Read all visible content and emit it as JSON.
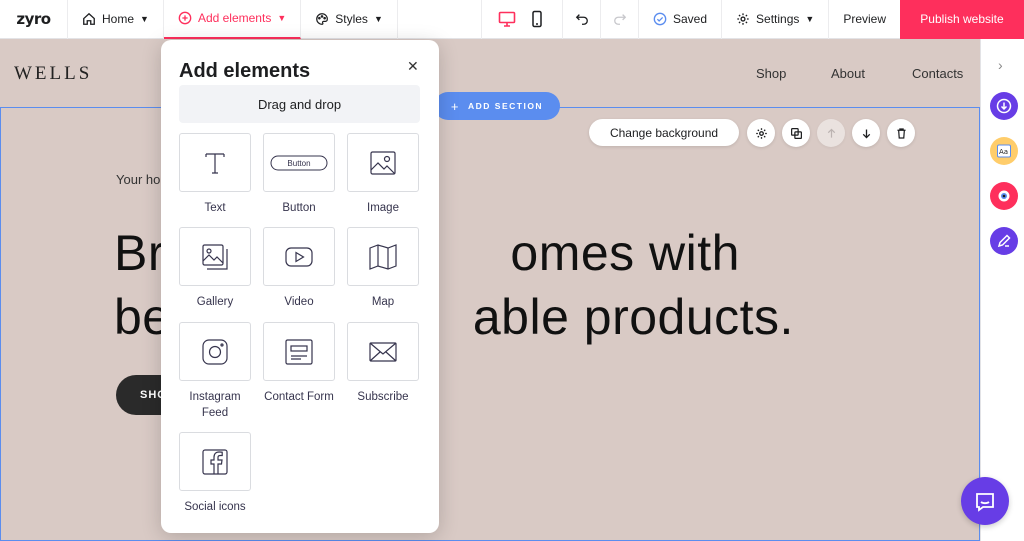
{
  "topbar": {
    "logo": "zyro",
    "home_label": "Home",
    "add_elements_label": "Add elements",
    "styles_label": "Styles",
    "saved_label": "Saved",
    "settings_label": "Settings",
    "preview_label": "Preview",
    "publish_label": "Publish website"
  },
  "site": {
    "brand": "WELLS",
    "nav": [
      "Shop",
      "About",
      "Contacts"
    ],
    "subtitle": "Your ho",
    "headline_line1": "Br                        omes with",
    "headline_line2": "be                     able products.",
    "shop_button": "SHO"
  },
  "section_tools": {
    "add_section_label": "ADD SECTION",
    "change_background_label": "Change background"
  },
  "panel": {
    "title": "Add elements",
    "drag_and_drop": "Drag and drop",
    "items": [
      {
        "label": "Text",
        "icon": "text-icon"
      },
      {
        "label": "Button",
        "icon": "button-icon",
        "inner": "Button"
      },
      {
        "label": "Image",
        "icon": "image-icon"
      },
      {
        "label": "Gallery",
        "icon": "gallery-icon"
      },
      {
        "label": "Video",
        "icon": "video-icon"
      },
      {
        "label": "Map",
        "icon": "map-icon"
      },
      {
        "label": "Instagram Feed",
        "icon": "instagram-icon"
      },
      {
        "label": "Contact Form",
        "icon": "contact-form-icon"
      },
      {
        "label": "Subscribe",
        "icon": "envelope-icon"
      },
      {
        "label": "Social icons",
        "icon": "facebook-icon"
      }
    ]
  },
  "colors": {
    "accent": "#fe2f5c",
    "selection": "#5b8def",
    "canvas_bg": "#d9cac5",
    "purple": "#673de6"
  }
}
